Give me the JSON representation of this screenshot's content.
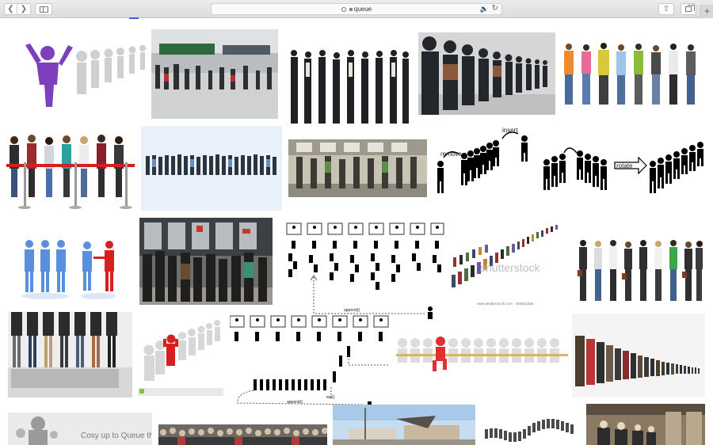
{
  "browser": {
    "address_text": "queue",
    "back_icon": "chevron-left-icon",
    "forward_icon": "chevron-right-icon",
    "new_tab_label": "+"
  },
  "results": {
    "image_texts": {
      "shutterstock": "shutterstock",
      "shutterstock_id": "www.shutterstock.com · 266822366",
      "cosy": "Cosy up to Queue this",
      "remove": "remove",
      "insert": "insert",
      "rotate": "rotate",
      "append": "append()",
      "top_label": "top()"
    }
  },
  "colors": {
    "toolbar": "#e2e2e2",
    "accent": "#3a5be0",
    "figure_purple": "#7e3fbd",
    "figure_red": "#d61f1f",
    "figure_blue": "#5a8fe0"
  }
}
